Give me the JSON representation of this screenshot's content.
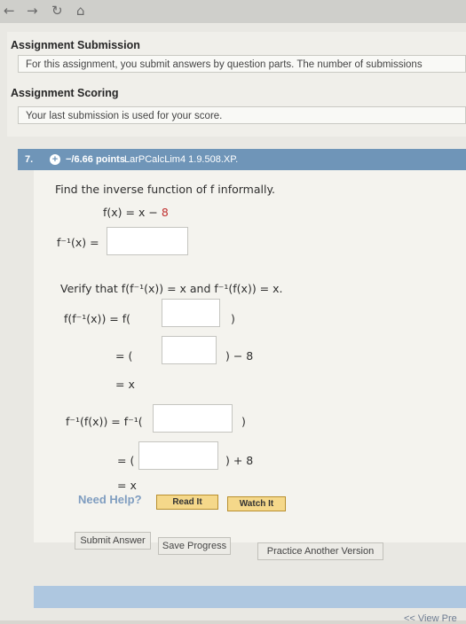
{
  "browser": {
    "back_icon": "back-arrow-icon",
    "forward_icon": "forward-arrow-icon",
    "reload_icon": "reload-icon",
    "home_icon": "home-icon"
  },
  "info": {
    "submission_heading": "Assignment Submission",
    "submission_text": "For this assignment, you submit answers by question parts. The number of submissions",
    "scoring_heading": "Assignment Scoring",
    "scoring_text": "Your last submission is used for your score."
  },
  "question": {
    "number": "7.",
    "points": "−/6.66 points",
    "source": "LarPCalcLim4 1.9.508.XP.",
    "prompt": "Find the inverse function of f informally.",
    "fx_label": "f(x) = x −",
    "fx_const": "8",
    "finv_label": "f⁻¹(x) =",
    "verify": "Verify that f(f⁻¹(x)) = x and f⁻¹(f(x)) = x.",
    "line1_lhs": "f(f⁻¹(x))  =  f(",
    "line1_close": ")",
    "line2_lhs": "= (",
    "line2_rhs": ") − 8",
    "line3": "= x",
    "line4_lhs": "f⁻¹(f(x))  =  f⁻¹(",
    "line4_close": ")",
    "line5_lhs": "= (",
    "line5_rhs": ") + 8",
    "line6": "= x"
  },
  "help": {
    "label": "Need Help?",
    "read_it": "Read It",
    "watch_it": "Watch It"
  },
  "actions": {
    "submit": "Submit Answer",
    "save": "Save Progress",
    "practice": "Practice Another Version"
  },
  "footer": {
    "view_previous": "<< View Pre"
  },
  "colors": {
    "question_header": "#6f95b8",
    "help_text": "#7f9dc0",
    "constant": "#c03030",
    "read_button": "#f5d88a"
  }
}
